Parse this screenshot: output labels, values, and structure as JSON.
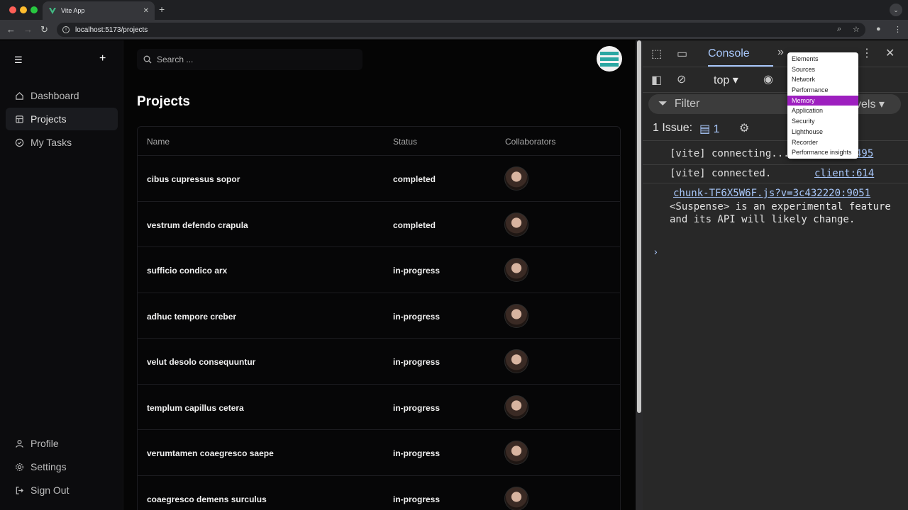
{
  "browser": {
    "tab_title": "Vite App",
    "url": "localhost:5173/projects",
    "new_tab": "+",
    "tab_close": "✕"
  },
  "sidebar": {
    "items": [
      {
        "label": "Dashboard",
        "icon": "home-icon"
      },
      {
        "label": "Projects",
        "icon": "projects-icon",
        "active": true
      },
      {
        "label": "My Tasks",
        "icon": "tasks-icon"
      }
    ],
    "bottom_items": [
      {
        "label": "Profile",
        "icon": "user-icon"
      },
      {
        "label": "Settings",
        "icon": "gear-icon"
      },
      {
        "label": "Sign Out",
        "icon": "sign-out-icon"
      }
    ]
  },
  "search": {
    "placeholder": "Search ..."
  },
  "page": {
    "title": "Projects"
  },
  "table": {
    "headers": {
      "name": "Name",
      "status": "Status",
      "collaborators": "Collaborators"
    },
    "rows": [
      {
        "name": "cibus cupressus sopor",
        "status": "completed"
      },
      {
        "name": "vestrum defendo crapula",
        "status": "completed"
      },
      {
        "name": "sufficio condico arx",
        "status": "in-progress"
      },
      {
        "name": "adhuc tempore creber",
        "status": "in-progress"
      },
      {
        "name": "velut desolo consequuntur",
        "status": "in-progress"
      },
      {
        "name": "templum capillus cetera",
        "status": "in-progress"
      },
      {
        "name": "verumtamen coaegresco saepe",
        "status": "in-progress"
      },
      {
        "name": "coaegresco demens surculus",
        "status": "in-progress"
      }
    ]
  },
  "devtools": {
    "active_tab": "Console",
    "context": "top",
    "filter": "Filter",
    "levels": "vels",
    "issues_label": "1 Issue:",
    "issues_count": "1",
    "log": [
      {
        "text": "[vite] connecting...",
        "source": "495"
      },
      {
        "text": "[vite] connected.",
        "source": "client:614"
      },
      {
        "source": "chunk-TF6X5W6F.js?v=3c432220:9051",
        "text": "<Suspense> is an experimental feature and its API will likely change."
      }
    ],
    "menu": [
      "Elements",
      "Sources",
      "Network",
      "Performance",
      "Memory",
      "Application",
      "Security",
      "Lighthouse",
      "Recorder",
      "Performance insights"
    ],
    "menu_selected": "Memory"
  },
  "colors": {
    "accent": "#2ba7a2",
    "menu_highlight": "#9d1fbf",
    "devtools_link": "#a8c7fa"
  }
}
